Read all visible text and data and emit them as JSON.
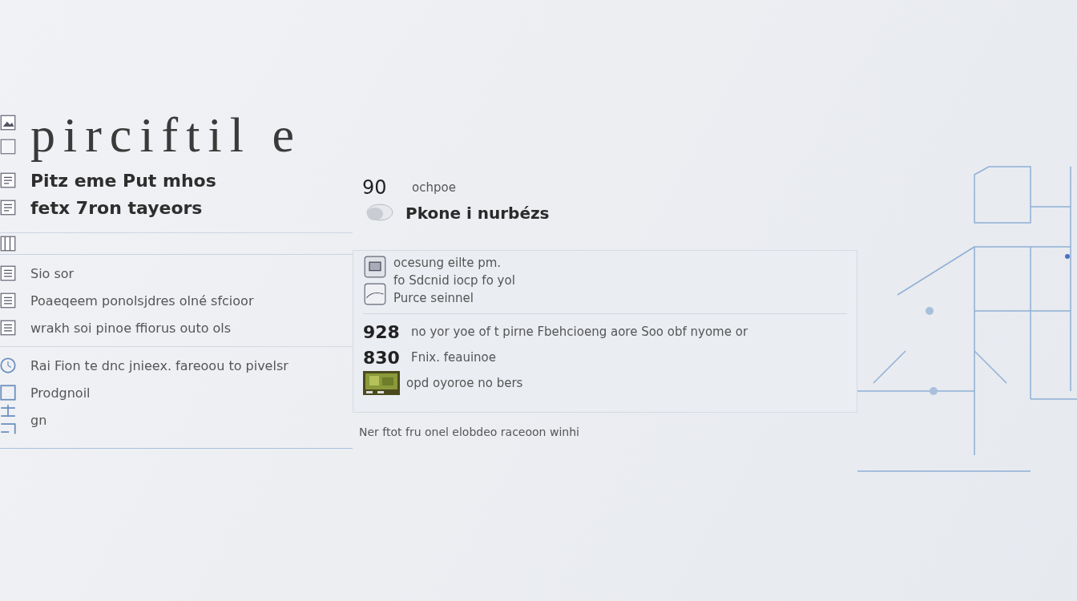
{
  "title": "pirciftil e",
  "left_header": [
    {
      "text": "Pitz eme Put mhos"
    },
    {
      "text": "fetx 7ron tayeors"
    }
  ],
  "left_list": [
    {
      "text": "Sio sor"
    },
    {
      "text": "Poaeqeem ponolsjdres olné sfcioor"
    },
    {
      "text": "wrakh soi pinoe ffiorus outo ols"
    }
  ],
  "left_more": [
    {
      "text": "Rai Fion te dnc jnieex. fareoou to pivelsr"
    },
    {
      "text": "Prodgnoil"
    },
    {
      "text": "gn"
    }
  ],
  "middle": {
    "count": "90",
    "count_label": "ochpoe",
    "heading": "Pkone i nurbézs",
    "rows": [
      {
        "text": "ocesung eilte pm."
      },
      {
        "text": "fo Sdcnid iocp fo yol"
      },
      {
        "text": "Purce seinnel"
      }
    ],
    "entries": [
      {
        "kind": "number",
        "number": "928",
        "text": "no yor yoe of t pirne Fbehcioeng  aore Soo obf nyome or"
      },
      {
        "kind": "number",
        "number": "830",
        "text": "Fnix. feauinoe"
      },
      {
        "kind": "picture",
        "text": "opd oyoroe no bers"
      }
    ],
    "footer": "Ner ftot fru onel elobdeo raceoon winhi"
  }
}
